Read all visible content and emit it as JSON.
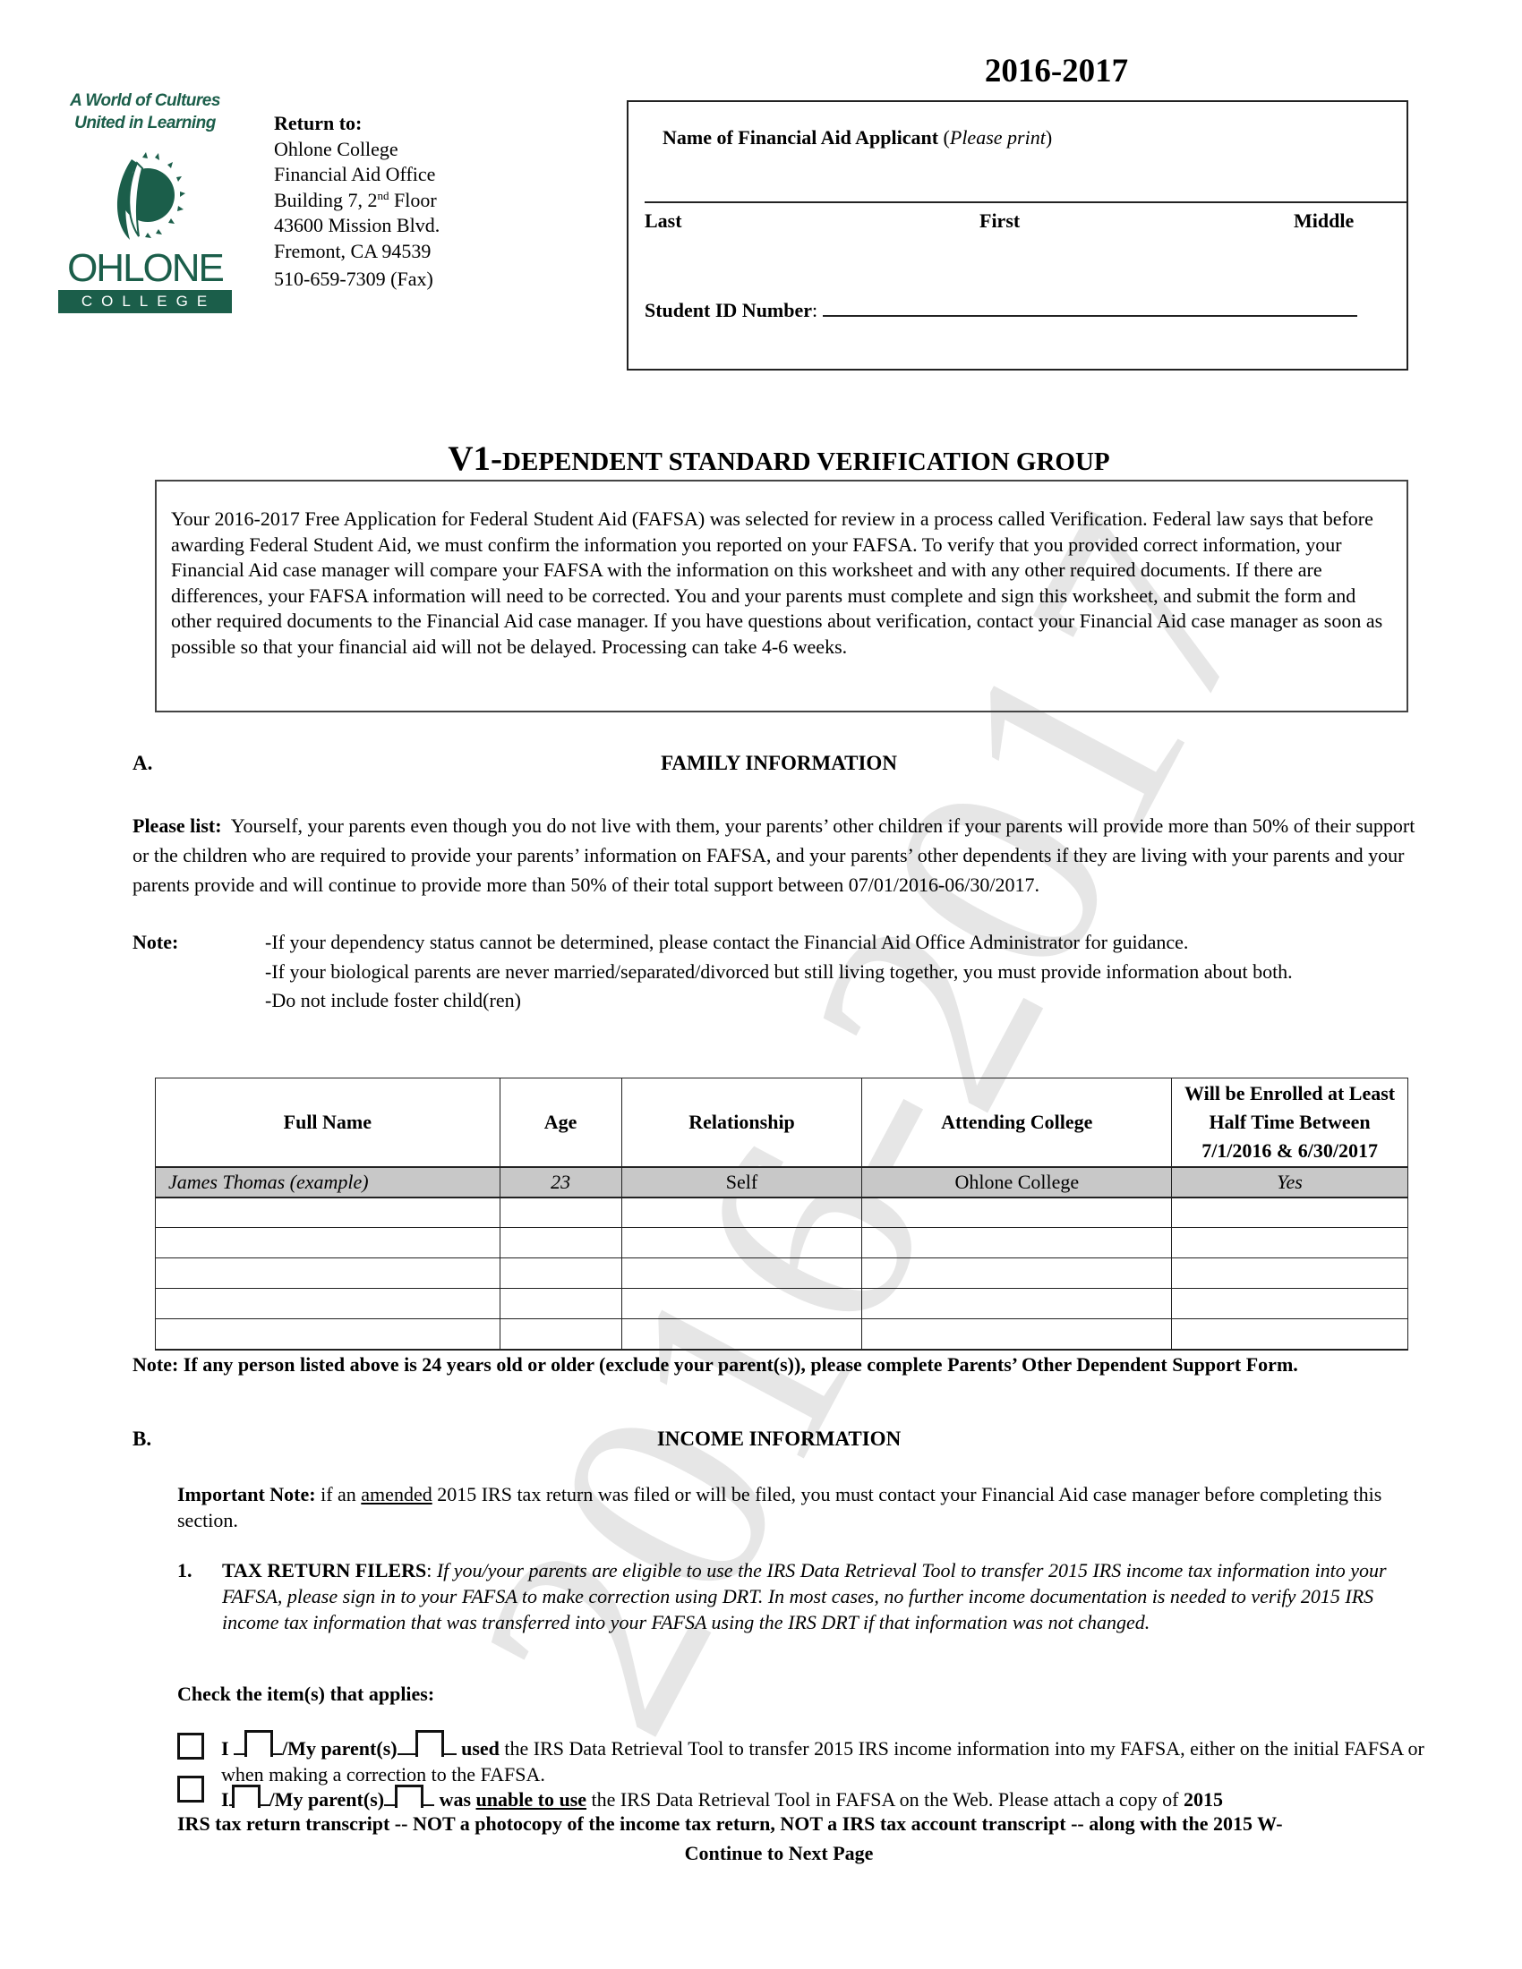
{
  "watermark": "2016-2017",
  "logo": {
    "tagline_line1": "A World of Cultures",
    "tagline_line2": "United in Learning",
    "wordmark": "OHLONE",
    "subword": "COLLEGE",
    "brand_color": "#1b5e4a"
  },
  "return_to": {
    "label": "Return to:",
    "lines": [
      "Ohlone College",
      "Financial Aid Office",
      "Building 7, 2",
      "43600 Mission Blvd.",
      "Fremont, CA  94539",
      "510-659-7309 (Fax)"
    ],
    "floor_sup": "nd",
    "floor_suffix": " Floor"
  },
  "award_year": "2016-2017",
  "applicant_box": {
    "heading_bold": "Name of Financial Aid Applicant",
    "heading_italic": "Please print",
    "last_label": "Last",
    "first_label": "First",
    "middle_label": "Middle",
    "student_id_label": "Student ID Number",
    "student_id_value": ""
  },
  "title": {
    "prefix": "V1-",
    "text": "DEPENDENT STANDARD VERIFICATION GROUP"
  },
  "intro": "Your 2016-2017 Free Application for Federal Student Aid (FAFSA) was selected for review in a process called Verification. Federal law says that before awarding Federal Student Aid, we must confirm the information you reported on your FAFSA. To verify that you provided correct information, your Financial Aid case manager will compare your FAFSA with the information on this worksheet and with any other required documents. If there are differences, your FAFSA information will need to be corrected. You and your parents must complete and sign this worksheet, and submit the form and other required documents to the Financial Aid case manager. If you have questions about verification, contact your Financial Aid case manager as soon as possible so that your financial aid will not be delayed. Processing can take 4-6 weeks.",
  "section_a": {
    "letter": "A.",
    "heading": "FAMILY INFORMATION",
    "please_list_label": "Please list:",
    "please_list_text": "Yourself, your parents even though you do not live with them, your parents’ other children if your parents will provide more than 50% of their support or the children who are required to provide your parents’ information on FAFSA, and your parents’ other dependents if they are living with your parents and your parents provide and will continue to provide more than 50% of their total support between 07/01/2016-06/30/2017.",
    "note_label": "Note:",
    "notes": [
      "-If your dependency status cannot be determined, please contact the Financial Aid Office Administrator for guidance.",
      "-If your biological parents are never married/separated/divorced but still living together, you must provide information about both.",
      "-Do not include foster child(ren)"
    ],
    "table": {
      "headers": [
        "Full Name",
        "Age",
        "Relationship",
        "Attending College",
        "Will be Enrolled at Least Half Time Between 7/1/2016 & 6/30/2017"
      ],
      "example_row": [
        "James Thomas (example)",
        "23",
        "Self",
        "Ohlone College",
        "Yes"
      ],
      "blank_rows": [
        [
          "",
          "",
          "",
          "",
          ""
        ],
        [
          "",
          "",
          "",
          "",
          ""
        ],
        [
          "",
          "",
          "",
          "",
          ""
        ],
        [
          "",
          "",
          "",
          "",
          ""
        ],
        [
          "",
          "",
          "",
          "",
          ""
        ]
      ]
    },
    "footnote": "Note: If any person listed above is 24 years old or older (exclude your parent(s)), please complete Parents’ Other Dependent Support Form."
  },
  "section_b": {
    "letter": "B.",
    "heading": "INCOME INFORMATION",
    "important_label": "Important Note:",
    "important_pre": " if an ",
    "important_underlined": "amended",
    "important_post": " 2015 IRS tax return was filed or will be filed, you must contact your Financial Aid case manager before completing this section.",
    "item_number": "1.",
    "item_title": "TAX RETURN FILERS",
    "item_text": "If you/your parents are eligible to use the IRS Data Retrieval Tool to transfer 2015 IRS income tax information into your FAFSA, please sign in to your FAFSA to make correction using DRT. In most cases, no further income documentation is needed to verify 2015 IRS income tax information that was transferred into your FAFSA using the IRS DRT if that information was not changed.",
    "check_label": "Check the item(s) that applies:",
    "options": [
      {
        "i_label": "I",
        "parents_label": "/My parent(s)",
        "verb": "used",
        "rest": " the IRS Data Retrieval Tool to transfer 2015 IRS income information into my FAFSA, either on the initial FAFSA or when making a correction to the FAFSA.",
        "checked": false
      },
      {
        "i_label": "I",
        "parents_label": "/My parent(s)",
        "verb": "was",
        "verb_underlined": "unable to use",
        "rest": " the IRS Data Retrieval Tool in FAFSA on the Web. Please attach a copy of ",
        "bold_tail": "2015 IRS tax return transcript -- NOT a photocopy of the income tax return, NOT a IRS tax account transcript -- along with the 2015 W-",
        "checked": false
      }
    ]
  },
  "continue_label": "Continue to Next Page"
}
